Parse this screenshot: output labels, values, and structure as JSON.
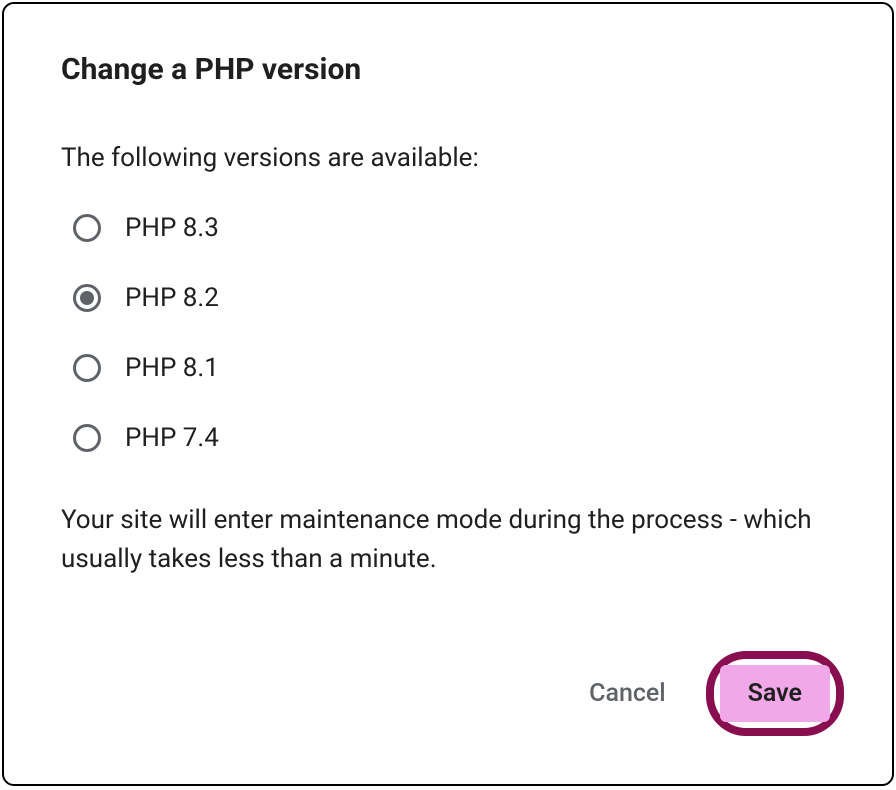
{
  "dialog": {
    "title": "Change a PHP version",
    "description": "The following versions are available:",
    "note": "Your site will enter maintenance mode during the process - which usually takes less than a minute."
  },
  "versions": [
    {
      "label": "PHP 8.3",
      "selected": false
    },
    {
      "label": "PHP 8.2",
      "selected": true
    },
    {
      "label": "PHP 8.1",
      "selected": false
    },
    {
      "label": "PHP 7.4",
      "selected": false
    }
  ],
  "buttons": {
    "cancel": "Cancel",
    "save": "Save"
  }
}
